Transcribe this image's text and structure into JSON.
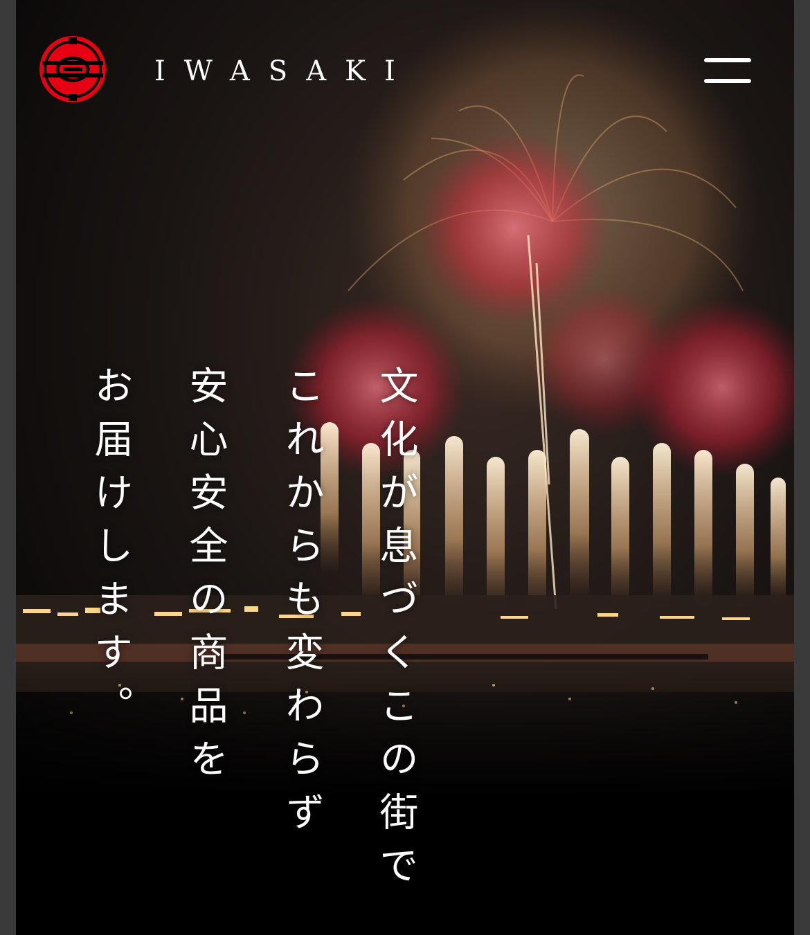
{
  "header": {
    "brand_name": "IWASAKI",
    "logo_icon": "iwasaki-crest-icon",
    "menu_icon": "hamburger-menu-icon"
  },
  "hero": {
    "background_description_icon": "fireworks-photo",
    "tagline": {
      "line1": "文化が息づくこの街で",
      "line2": "これからも変わらず",
      "line3": "安心安全の商品を",
      "line4": "お届けします。"
    }
  },
  "colors": {
    "brand_red": "#e60012",
    "text": "#ffffff",
    "background": "#000000"
  }
}
